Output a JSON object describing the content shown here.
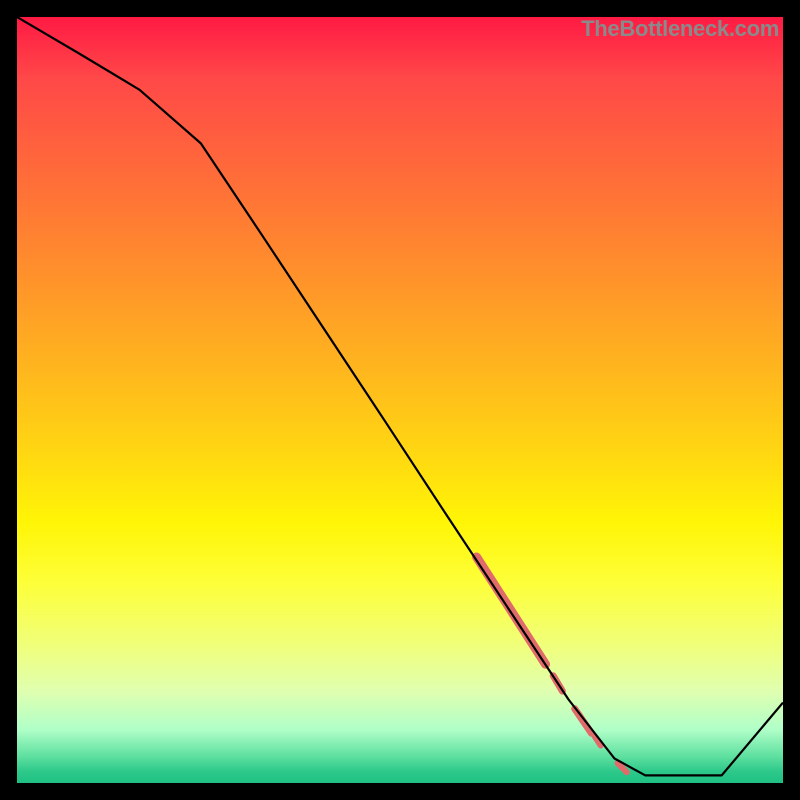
{
  "attribution": "TheBottleneck.com",
  "chart_data": {
    "type": "line",
    "title": "",
    "xlabel": "",
    "ylabel": "",
    "xlim": [
      0,
      100
    ],
    "ylim": [
      0,
      100
    ],
    "series": [
      {
        "name": "curve",
        "x": [
          0,
          8,
          16,
          24,
          32,
          40,
          48,
          56,
          64,
          72,
          78,
          82,
          86,
          92,
          100
        ],
        "y": [
          100,
          95.3,
          90.5,
          83.5,
          71.5,
          59.4,
          47.3,
          35.1,
          23.0,
          10.9,
          3.2,
          1.0,
          1.0,
          1.0,
          10.5
        ]
      }
    ],
    "highlight_segments": [
      {
        "x0": 60.0,
        "y0": 29.5,
        "x1": 69.0,
        "y1": 15.5,
        "width": 9
      },
      {
        "x0": 70.0,
        "y0": 14.0,
        "x1": 71.2,
        "y1": 12.0,
        "width": 7
      },
      {
        "x0": 72.8,
        "y0": 9.7,
        "x1": 75.0,
        "y1": 6.5,
        "width": 7
      },
      {
        "x0": 75.4,
        "y0": 6.1,
        "x1": 76.2,
        "y1": 4.9,
        "width": 6
      },
      {
        "x0": 78.4,
        "y0": 2.6,
        "x1": 79.6,
        "y1": 1.4,
        "width": 6
      }
    ],
    "colors": {
      "curve": "#000000",
      "highlight": "#e16a6a"
    }
  }
}
